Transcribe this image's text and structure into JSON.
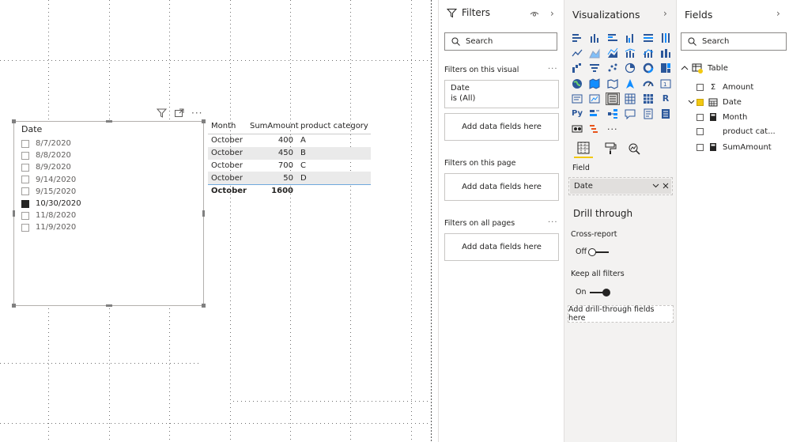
{
  "slicer": {
    "title": "Date",
    "items": [
      {
        "label": "8/7/2020",
        "checked": false
      },
      {
        "label": "8/8/2020",
        "checked": false
      },
      {
        "label": "8/9/2020",
        "checked": false
      },
      {
        "label": "9/14/2020",
        "checked": false
      },
      {
        "label": "9/15/2020",
        "checked": false
      },
      {
        "label": "10/30/2020",
        "checked": true
      },
      {
        "label": "11/8/2020",
        "checked": false
      },
      {
        "label": "11/9/2020",
        "checked": false
      }
    ],
    "header_icons": [
      "filter-icon",
      "focus-mode-icon",
      "more-options-icon"
    ],
    "more_glyph": "···"
  },
  "table": {
    "columns": [
      "Month",
      "SumAmount",
      "product category"
    ],
    "rows": [
      [
        "October",
        "400",
        "A"
      ],
      [
        "October",
        "450",
        "B"
      ],
      [
        "October",
        "700",
        "C"
      ],
      [
        "October",
        "50",
        "D"
      ]
    ],
    "total": [
      "October",
      "1600",
      ""
    ]
  },
  "filters": {
    "title": "Filters",
    "search_placeholder": "Search",
    "on_visual_label": "Filters on this visual",
    "card_field": "Date",
    "card_state": "is (All)",
    "add_fields": "Add data fields here",
    "on_page_label": "Filters on this page",
    "on_all_pages_label": "Filters on all pages",
    "more": "···"
  },
  "visualizations": {
    "title": "Visualizations",
    "field_label": "Field",
    "field_value": "Date",
    "drill_title": "Drill through",
    "cross_report_label": "Cross-report",
    "cross_report_state": "Off",
    "keep_filters_label": "Keep all filters",
    "keep_filters_state": "On",
    "drill_drop": "Add drill-through fields here",
    "r_glyph": "R",
    "py_glyph": "Py",
    "more_glyph": "···"
  },
  "fields": {
    "title": "Fields",
    "search_placeholder": "Search",
    "table_name": "Table",
    "items": [
      {
        "label": "Amount",
        "icon": "sigma-icon",
        "glyph": "Σ",
        "checked": false
      },
      {
        "label": "Date",
        "icon": "calendar-icon",
        "glyph": "",
        "checked": true
      },
      {
        "label": "Month",
        "icon": "calculator-icon",
        "glyph": "",
        "checked": false
      },
      {
        "label": "product cat...",
        "icon": "",
        "glyph": "",
        "checked": false
      },
      {
        "label": "SumAmount",
        "icon": "calculator-icon",
        "glyph": "",
        "checked": false
      }
    ]
  },
  "colors": {
    "accent": "#f2c811",
    "selected_checkbox": "#252423",
    "table_alt_row": "#eaeaea",
    "total_border": "#6fa8dc"
  }
}
